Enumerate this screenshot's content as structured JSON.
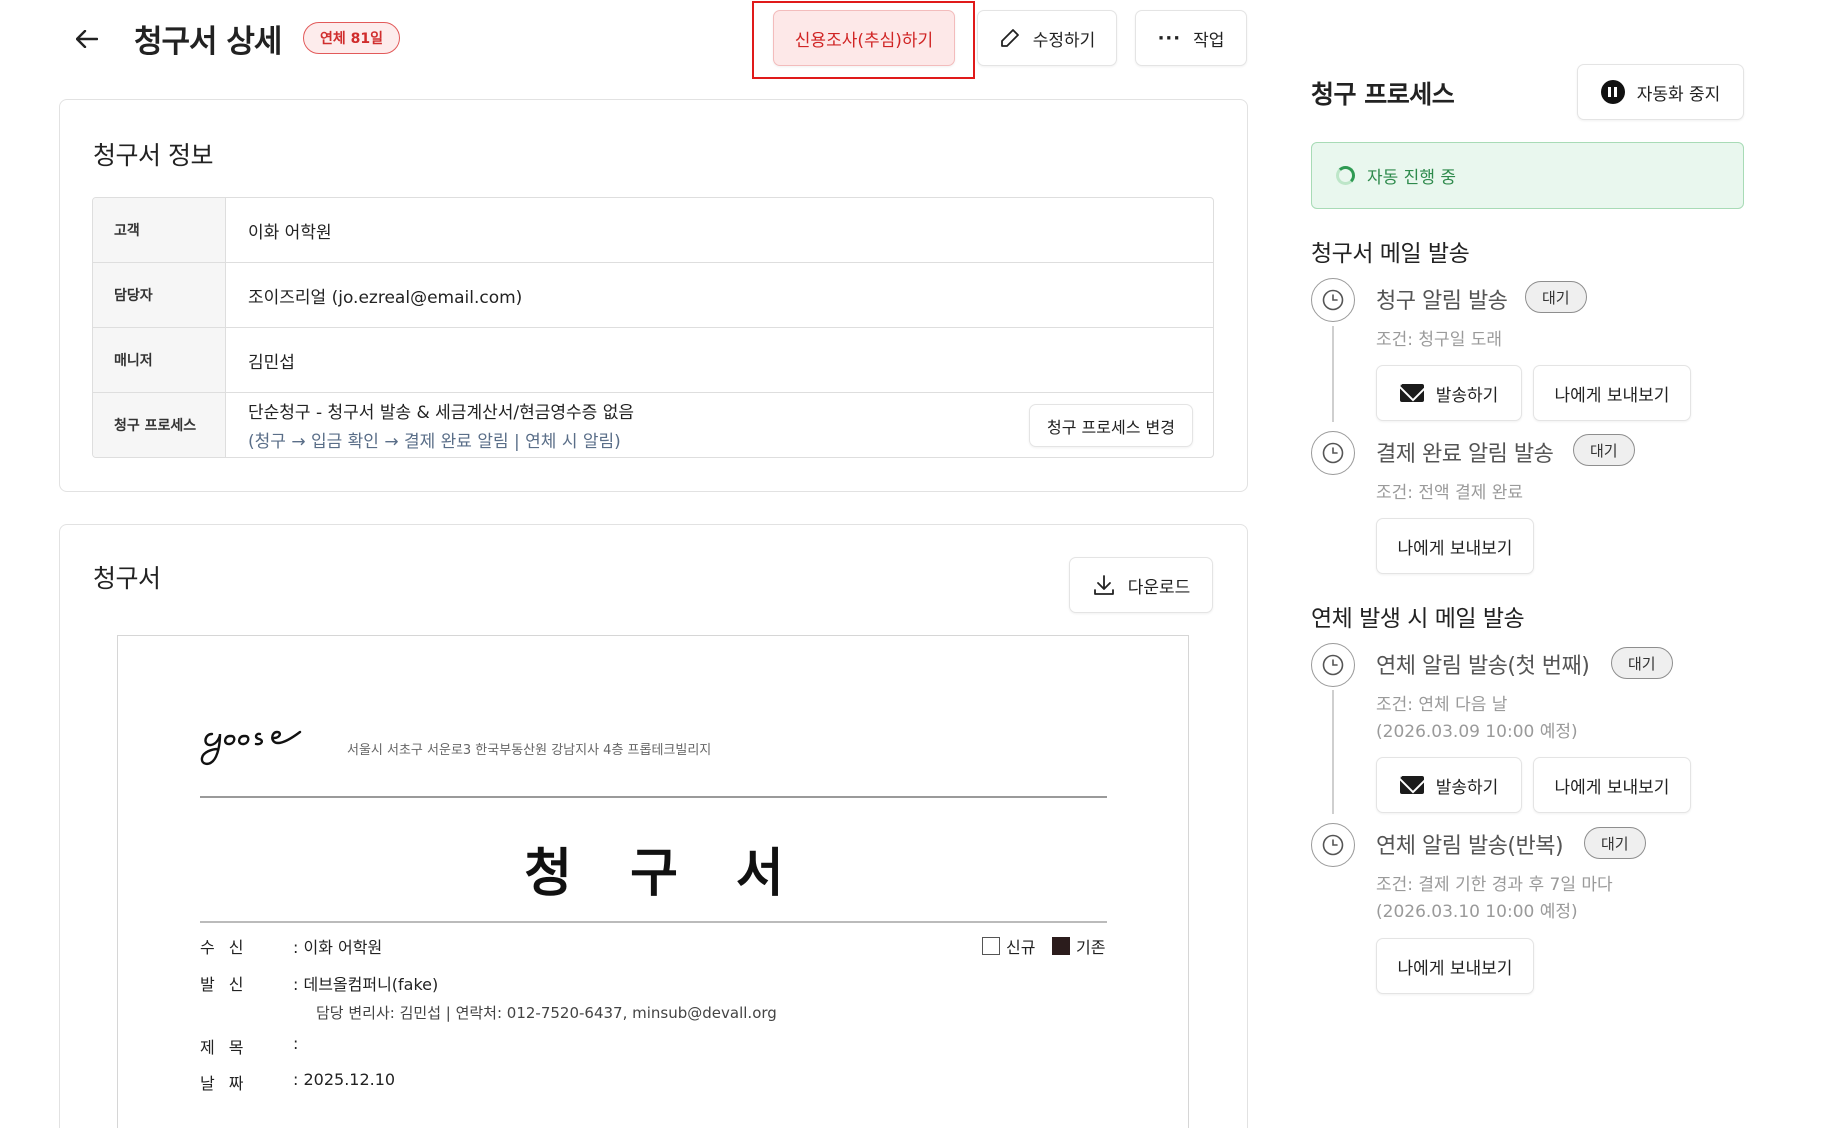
{
  "header": {
    "title": "청구서 상세",
    "overdue_badge": "연체 81일",
    "credit_button": "신용조사(추심)하기",
    "edit_button": "수정하기",
    "work_button": "작업"
  },
  "info_card": {
    "title": "청구서 정보",
    "rows": [
      {
        "label": "고객",
        "value": "이화 어학원"
      },
      {
        "label": "담당자",
        "value": "조이즈리얼 (jo.ezreal@email.com)"
      },
      {
        "label": "매니저",
        "value": "김민섭"
      },
      {
        "label": "청구 프로세스",
        "value": "단순청구 - 청구서 발송 & 세금계산서/현금영수증 없음",
        "sub": "(청구 → 입금 확인 → 결제 완료 알림  |  연체 시 알림)"
      }
    ],
    "process_change_button": "청구 프로세스 변경"
  },
  "invoice_card": {
    "title": "청구서",
    "download_button": "다운로드",
    "paper": {
      "logo_text": "goose",
      "address": "서울시 서초구 서운로3 한국부동산원 강남지사 4층 프롭테크빌리지",
      "doc_title": "청구서",
      "recipient_label": "수신",
      "recipient_value": ": 이화 어학원",
      "sender_label": "발신",
      "sender_value": ": 데브올컴퍼니(fake)",
      "sender_contact": "담당 변리사: 김민섭 | 연락처: 012-7520-6437, minsub@devall.org",
      "subject_label": "제목",
      "subject_value": ":",
      "date_label": "날짜",
      "date_value": ": 2025.12.10",
      "check_new": "신규",
      "check_existing": "기존"
    }
  },
  "right_panel": {
    "title": "청구 프로세스",
    "pause_button": "자동화 중지",
    "auto_status": "자동 진행 중",
    "section1": {
      "title": "청구서 메일 발송",
      "steps": [
        {
          "title": "청구 알림 발송",
          "badge": "대기",
          "condition": "조건: 청구일 도래",
          "send_button": "발송하기",
          "self_button": "나에게 보내보기"
        },
        {
          "title": "결제 완료 알림 발송",
          "badge": "대기",
          "condition": "조건: 전액 결제 완료",
          "self_button": "나에게 보내보기"
        }
      ]
    },
    "section2": {
      "title": "연체 발생 시 메일 발송",
      "steps": [
        {
          "title": "연체 알림 발송(첫 번째)",
          "badge": "대기",
          "condition": "조건: 연체 다음 날",
          "condition2": "(2026.03.09 10:00 예정)",
          "send_button": "발송하기",
          "self_button": "나에게 보내보기"
        },
        {
          "title": "연체 알림 발송(반복)",
          "badge": "대기",
          "condition": "조건: 결제 기한 경과 후 7일 마다",
          "condition2": "(2026.03.10 10:00 예정)",
          "self_button": "나에게 보내보기"
        }
      ]
    }
  }
}
